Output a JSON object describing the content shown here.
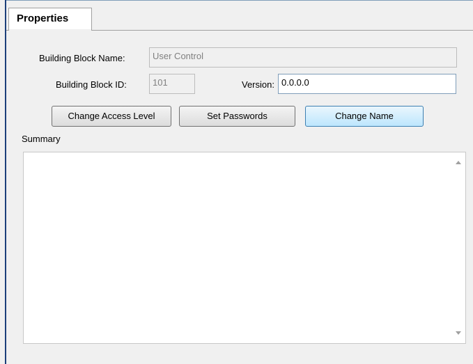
{
  "tab": {
    "label": "Properties"
  },
  "form": {
    "block_name_label": "Building Block Name:",
    "block_name_value": "User Control",
    "block_id_label": "Building Block ID:",
    "block_id_value": "101",
    "version_label": "Version:",
    "version_value": "0.0.0.0"
  },
  "buttons": {
    "change_access": "Change Access Level",
    "set_passwords": "Set Passwords",
    "change_name": "Change Name"
  },
  "summary": {
    "label": "Summary",
    "value": ""
  }
}
